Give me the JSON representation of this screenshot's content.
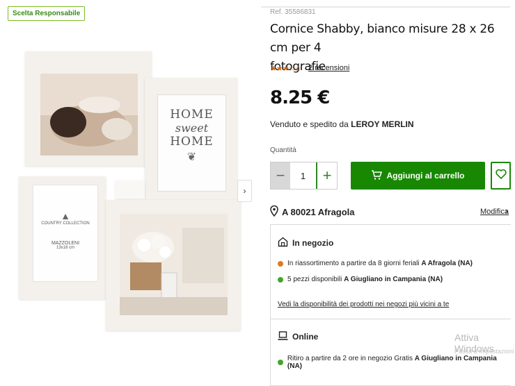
{
  "badge": "Scelta Responsabile",
  "product": {
    "ref": "Ref. 35586831",
    "title_line1": "Cornice Shabby, bianco misure 28 x 26 cm per 4",
    "title_line2": "fotografie",
    "rating_stars": "★★★☆☆",
    "rating_value": 3,
    "reviews": "2 recensioni",
    "price": "8.25 €",
    "seller_prefix": "Venduto e spedito da",
    "seller_name": "LEROY MERLIN"
  },
  "frame_texts": {
    "home_sweet_home_1": "HOME",
    "home_sweet_home_2": "sweet",
    "home_sweet_home_3": "HOME",
    "brand_1": "COUNTRY COLLECTION",
    "brand_2": "MAZZOLENI",
    "brand_3": "13x18 cm"
  },
  "quantity": {
    "label": "Quantità",
    "value": "1",
    "minus": "−",
    "plus": "+"
  },
  "cart_button": "Aggiungi al carrello",
  "location": {
    "text": "A 80021 Afragola",
    "modify": "Modifica",
    "chevron": "›"
  },
  "in_store": {
    "title": "In negozio",
    "line1_prefix": "In riassortimento a partire da 8 giorni feriali",
    "line1_store": "A Afragola (NA)",
    "line2_prefix": "5 pezzi disponibili",
    "line2_store": "A Giugliano in Campania (NA)",
    "link": "Vedi la disponibilità dei prodotti nei negozi più vicini a te"
  },
  "online": {
    "title": "Online",
    "line1_prefix": "Ritiro a partire da 2 ore in negozio Gratis",
    "line1_store": "A Giugliano in Campania (NA)"
  },
  "watermark": {
    "line1": "Attiva Windows",
    "line2": "Passa a Impostazioni"
  },
  "colors": {
    "accent_green": "#188803",
    "badge_green": "#78be20",
    "star_orange": "#d06a12",
    "status_orange": "#e07b1f",
    "status_green": "#46a528"
  }
}
